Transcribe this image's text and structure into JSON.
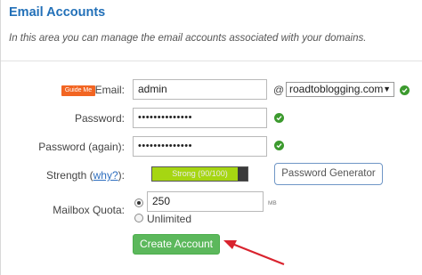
{
  "section": {
    "title": "Email Accounts",
    "description": "In this area you can manage the email accounts associated with your domains."
  },
  "form": {
    "guide_badge": "Guide Me",
    "email_label": "Email:",
    "email_value": "admin",
    "at_symbol": "@",
    "domain_selected": "roadtoblogging.com",
    "domain_arrow": "▼",
    "password_label": "Password:",
    "password_value": "••••••••••••••",
    "password_again_label": "Password (again):",
    "password_again_value": "••••••••••••••",
    "strength_label": "Strength (",
    "strength_why": "why?",
    "strength_label_end": "):",
    "strength_text": "Strong (90/100)",
    "strength_fraction": 0.9,
    "password_generator_label": "Password Generator",
    "quota_label": "Mailbox Quota:",
    "quota_value": "250",
    "quota_unit": "MB",
    "unlimited_label": "Unlimited",
    "quota_mode": "limited",
    "create_button_label": "Create Account"
  },
  "colors": {
    "title": "#2270b8",
    "create_button": "#5cb85c",
    "guide_badge": "#f26522",
    "valid_check": "#3c9a2e",
    "strength_fill": "#a6d612",
    "annotation_arrow": "#d9232e"
  },
  "icons": {
    "valid": "check-circle-icon",
    "annotation": "red-arrow-icon"
  }
}
